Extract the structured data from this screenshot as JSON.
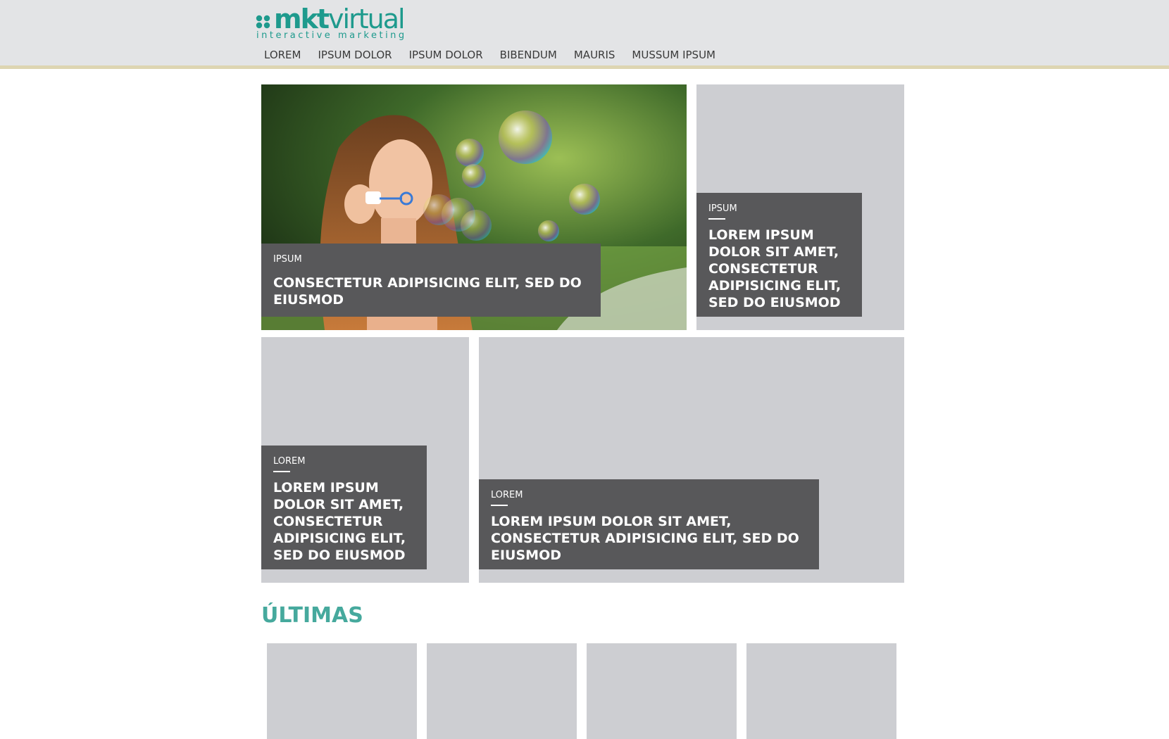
{
  "brand": {
    "name_bold": "mkt",
    "name_rest": "virtual",
    "tagline": "interactive marketing",
    "color": "#1e9a8d"
  },
  "nav": {
    "items": [
      {
        "label": "LOREM"
      },
      {
        "label": "IPSUM DOLOR"
      },
      {
        "label": "IPSUM DOLOR"
      },
      {
        "label": "BIBENDUM"
      },
      {
        "label": "MAURIS"
      },
      {
        "label": "MUSSUM IPSUM"
      }
    ]
  },
  "featured": [
    {
      "category": "IPSUM",
      "title": "CONSECTETUR ADIPISICING ELIT, SED DO EIUSMOD",
      "image": "woman-blowing-bubbles"
    },
    {
      "category": "IPSUM",
      "title": "LOREM IPSUM DOLOR SIT AMET, CONSECTETUR ADIPISICING ELIT, SED DO EIUSMOD"
    },
    {
      "category": "LOREM",
      "title": "LOREM IPSUM DOLOR SIT AMET, CONSECTETUR ADIPISICING ELIT, SED DO EIUSMOD"
    },
    {
      "category": "LOREM",
      "title": "LOREM IPSUM DOLOR SIT AMET, CONSECTETUR ADIPISICING ELIT, SED DO EIUSMOD"
    }
  ],
  "latest": {
    "heading": "ÚLTIMAS",
    "color": "#46a99d"
  },
  "colors": {
    "header_bg": "#e3e4e6",
    "header_border": "#ddd5b2",
    "tile_bg": "#cdced2",
    "caption_bg": "#58585a"
  }
}
